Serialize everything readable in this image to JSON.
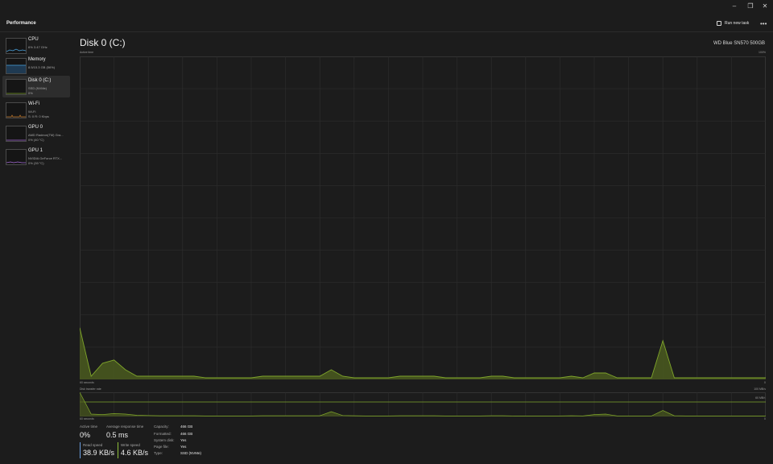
{
  "window_controls": {
    "minimize": "–",
    "maximize": "❐",
    "close": "✕"
  },
  "header": {
    "title": "Performance",
    "run_new_task": "Run new task",
    "more": "•••"
  },
  "sidebar": {
    "items": [
      {
        "name": "CPU",
        "line2": "6% 3.47 GHz",
        "line3": "",
        "color": "#4aa3df"
      },
      {
        "name": "Memory",
        "line2": "8.5/15.3 GB (56%)",
        "line3": "",
        "color": "#4aa3df"
      },
      {
        "name": "Disk 0 (C:)",
        "line2": "SSD (NVMe)",
        "line3": "0%",
        "color": "#7fa52b"
      },
      {
        "name": "Wi-Fi",
        "line2": "Wi-Fi",
        "line3": "S: 0 R: 0 Kbps",
        "color": "#c77c2d"
      },
      {
        "name": "GPU 0",
        "line2": "AMD Radeon(TM) Gra...",
        "line3": "0% (40 °C)",
        "color": "#a46ad6"
      },
      {
        "name": "GPU 1",
        "line2": "NVIDIA GeForce RTX...",
        "line3": "0% (39 °C)",
        "color": "#a46ad6"
      }
    ]
  },
  "main": {
    "title": "Disk 0 (C:)",
    "model": "WD Blue SN570 500GB",
    "chart1": {
      "label": "Active time",
      "max_label": "100%",
      "time_label": "60 seconds",
      "min_label": "0"
    },
    "chart2": {
      "label": "Disk transfer rate",
      "max_label": "100 MB/s",
      "ref_label": "60 MB/s",
      "time_label": "60 seconds",
      "min_label": "0"
    }
  },
  "stats": {
    "active_time": {
      "label": "Active time",
      "value": "0%"
    },
    "avg_response": {
      "label": "Average response time",
      "value": "0.5 ms"
    },
    "read_speed": {
      "label": "Read speed",
      "value": "38.9 KB/s"
    },
    "write_speed": {
      "label": "Write speed",
      "value": "4.6 KB/s"
    }
  },
  "info": [
    {
      "label": "Capacity:",
      "value": "466 GB"
    },
    {
      "label": "Formatted:",
      "value": "466 GB"
    },
    {
      "label": "System disk:",
      "value": "Yes"
    },
    {
      "label": "Page file:",
      "value": "Yes"
    },
    {
      "label": "Type:",
      "value": "SSD (NVMe)"
    }
  ],
  "colors": {
    "accent": "#7fa52b",
    "fill": "#4a5a1e",
    "grid": "#2e2e2e",
    "bg": "#1c1c1c",
    "read_bar": "#6a9ee0",
    "write_bar": "#8fbf3a"
  },
  "chart_data": [
    {
      "type": "area",
      "label": "Active time",
      "x_range_seconds": [
        60,
        0
      ],
      "ylim": [
        0,
        100
      ],
      "values": [
        16,
        1,
        5,
        6,
        3,
        1,
        1,
        1,
        1,
        1,
        1,
        0.5,
        0.5,
        0.5,
        0.5,
        0.5,
        1,
        1,
        1,
        1,
        1,
        1,
        3,
        1,
        0.5,
        0.5,
        0.5,
        0.5,
        1,
        1,
        1,
        1,
        0.5,
        0.5,
        0.5,
        0.5,
        1,
        1,
        0.5,
        0.5,
        0.5,
        0.5,
        0.5,
        1,
        0.5,
        2,
        2,
        0.5,
        0.5,
        0.5,
        0.5,
        12,
        0.5,
        0.5,
        0.5,
        0.5,
        0.5,
        0.5,
        0.5,
        0.5,
        0.5
      ]
    },
    {
      "type": "line",
      "label": "Disk transfer rate",
      "ylim": [
        0,
        100
      ],
      "series": [
        {
          "values": [
            100,
            10,
            8,
            12,
            10,
            5,
            4,
            3,
            3,
            3,
            3,
            2,
            2,
            2,
            2,
            2,
            3,
            3,
            3,
            3,
            3,
            3,
            20,
            4,
            3,
            2,
            2,
            2,
            3,
            3,
            3,
            3,
            2,
            2,
            2,
            2,
            3,
            3,
            2,
            2,
            2,
            2,
            2,
            3,
            2,
            8,
            10,
            2,
            2,
            2,
            2,
            25,
            3,
            2,
            2,
            2,
            2,
            2,
            2,
            2,
            2
          ]
        }
      ]
    }
  ]
}
